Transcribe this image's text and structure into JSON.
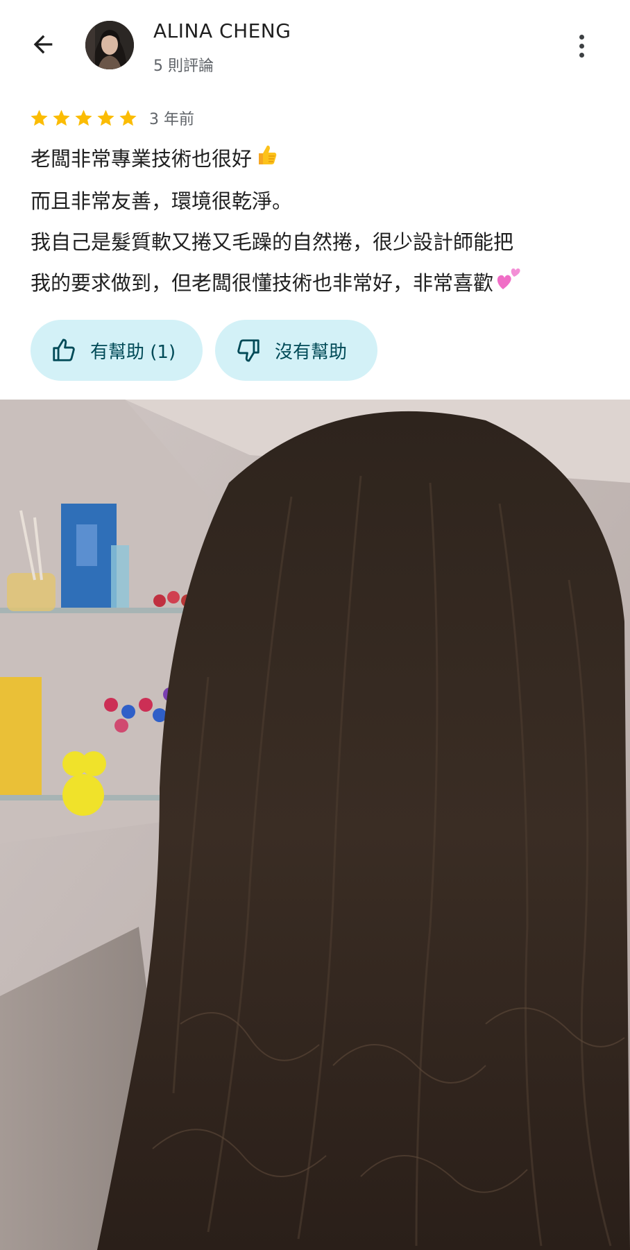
{
  "header": {
    "author_name": "ALINA CHENG",
    "review_count": "5 則評論",
    "back_icon": "arrow-left-icon",
    "more_icon": "more-vertical-icon"
  },
  "review": {
    "rating": 5,
    "rating_max": 5,
    "date": "3 年前",
    "lines": [
      "老闆非常專業技術也很好",
      "而且非常友善，環境很乾淨。",
      "我自己是髮質軟又捲又毛躁的自然捲，很少設計師能把",
      "我的要求做到，但老闆很懂技術也非常好，非常喜歡"
    ],
    "emojis": [
      "thumbs-up-emoji",
      "two-hearts-emoji"
    ]
  },
  "actions": {
    "helpful_label": "有幫助 (1)",
    "not_helpful_label": "沒有幫助"
  },
  "photo": {
    "description_icon": "review-photo"
  },
  "colors": {
    "star": "#fbbc04",
    "pill_bg": "#d3f1f7",
    "pill_text": "#004a57",
    "secondary_text": "#5f6368"
  }
}
